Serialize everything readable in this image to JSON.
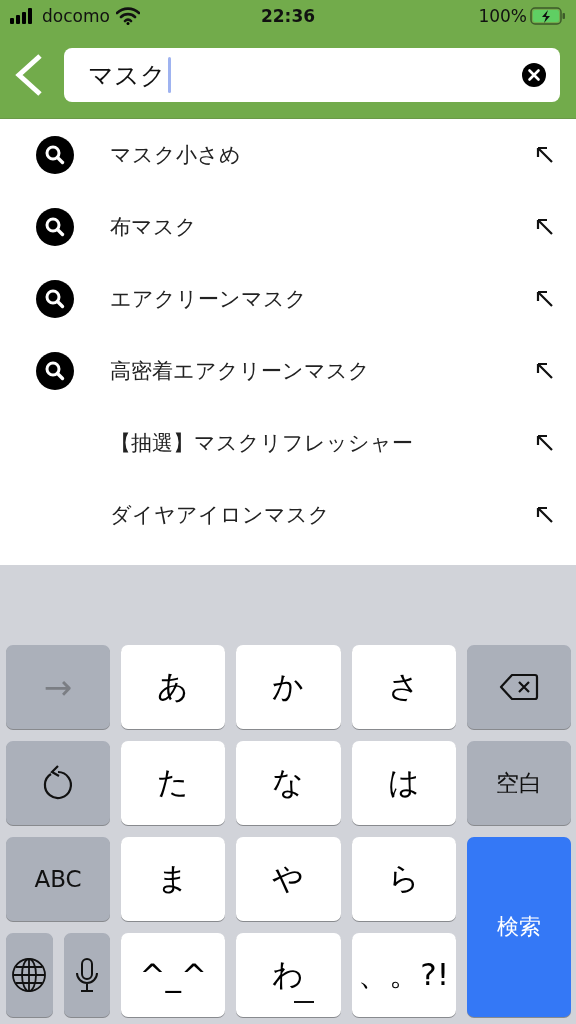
{
  "status_bar": {
    "carrier": "docomo",
    "time": "22:36",
    "battery": "100%"
  },
  "search": {
    "value": "マスク"
  },
  "suggestions": [
    {
      "text": "マスク小さめ",
      "kind": "search"
    },
    {
      "text": "布マスク",
      "kind": "search"
    },
    {
      "text": "エアクリーンマスク",
      "kind": "search"
    },
    {
      "text": "高密着エアクリーンマスク",
      "kind": "search"
    },
    {
      "text": "【抽選】マスクリフレッシャー",
      "kind": "plain"
    },
    {
      "text": "ダイヤアイロンマスク",
      "kind": "plain"
    }
  ],
  "keyboard": {
    "keys": [
      {
        "kind": "arrow",
        "label": "→"
      },
      {
        "kind": "kana",
        "label": "あ"
      },
      {
        "kind": "kana",
        "label": "か"
      },
      {
        "kind": "kana",
        "label": "さ"
      },
      {
        "kind": "backspace"
      },
      {
        "kind": "undo"
      },
      {
        "kind": "kana",
        "label": "た"
      },
      {
        "kind": "kana",
        "label": "な"
      },
      {
        "kind": "kana",
        "label": "は"
      },
      {
        "kind": "function",
        "label": "空白"
      },
      {
        "kind": "function",
        "label": "ABC"
      },
      {
        "kind": "kana",
        "label": "ま"
      },
      {
        "kind": "kana",
        "label": "や"
      },
      {
        "kind": "kana",
        "label": "ら"
      },
      {
        "kind": "action",
        "label": "検索"
      },
      {
        "kind": "globe"
      },
      {
        "kind": "mic"
      },
      {
        "kind": "kana",
        "label": "^_^"
      },
      {
        "kind": "underlined",
        "label": "わ"
      },
      {
        "kind": "kana",
        "label": "、。?!"
      }
    ]
  }
}
